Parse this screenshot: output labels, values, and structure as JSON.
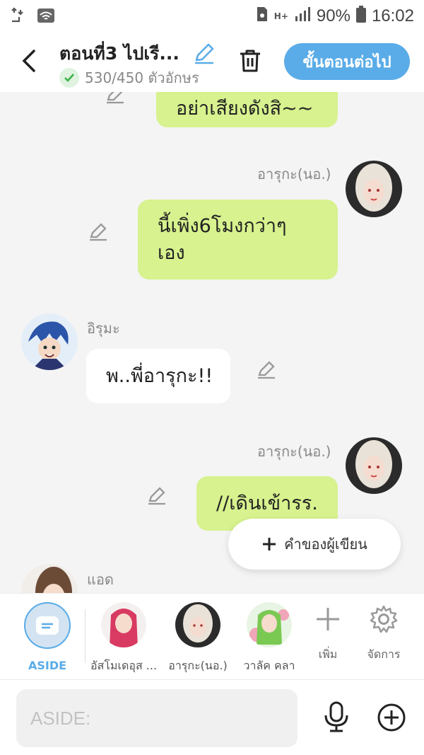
{
  "status_bar": {
    "battery_pct": "90%",
    "time": "16:02",
    "network": "H+"
  },
  "header": {
    "title": "ตอนที่3 ไปเรี...",
    "char_count": "530/450 ตัวอักษร",
    "next_label": "ขั้นตอนต่อไป"
  },
  "messages": [
    {
      "sender": "",
      "text": "อย่าเสียงดังสิ~~",
      "side": "me"
    },
    {
      "sender": "อารุกะ(นอ.)",
      "text_lines": [
        "นี้เพิ่ง6โมงกว่าๆ",
        "เอง"
      ],
      "side": "me"
    },
    {
      "sender": "อิรุมะ",
      "text": "พ..พี่อารุกะ!!",
      "side": "other"
    },
    {
      "sender": "อารุกะ(นอ.)",
      "text": "//เดินเข้ารร.",
      "side": "me"
    },
    {
      "sender": "แอด",
      "text": "",
      "side": "other"
    }
  ],
  "author_note_label": "คำของผู้เขียน",
  "character_bar": {
    "aside_label": "ASIDE",
    "characters": [
      {
        "name": "อัสโมเดอุส ..."
      },
      {
        "name": "อารุกะ(นอ.)"
      },
      {
        "name": "วาลัค คลา"
      }
    ],
    "add_label": "เพิ่ม",
    "manage_label": "จัดการ"
  },
  "input": {
    "placeholder": "ASIDE:",
    "value": ""
  },
  "colors": {
    "accent": "#5aace8",
    "my_bubble": "#d7f28e",
    "other_bubble": "#ffffff",
    "background": "#f4f4f4"
  }
}
